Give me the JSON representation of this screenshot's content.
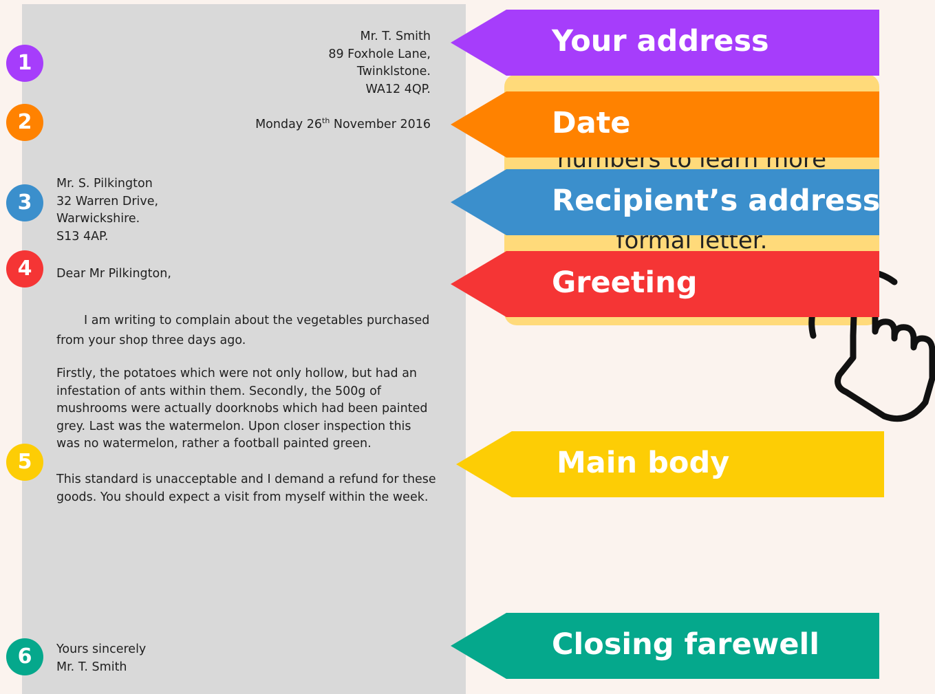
{
  "letter": {
    "sender": [
      "Mr. T. Smith",
      "89 Foxhole Lane,",
      "Twinklstone.",
      "WA12 4QP."
    ],
    "date": {
      "prefix": "Monday 26",
      "suffix": "th",
      "rest": " November 2016"
    },
    "recipient": [
      "Mr. S. Pilkington",
      "32 Warren Drive,",
      "Warwickshire.",
      "S13 4AP."
    ],
    "greeting": "Dear Mr Pilkington,",
    "body": [
      "I am writing to complain about the vegetables purchased from your shop three days ago.",
      "Firstly, the potatoes which were not only hollow, but had an infestation of ants within them. Secondly, the 500g of mushrooms were actually doorknobs which had been painted grey. Last was the watermelon. Upon closer inspection this was no watermelon, rather a football painted green.",
      "This standard is unacceptable and I demand a refund for these goods. You should expect a visit from myself within the week."
    ],
    "closing": [
      "Yours sincerely",
      "Mr. T. Smith"
    ]
  },
  "badges": [
    {
      "number": "1",
      "color": "#a63dfb"
    },
    {
      "number": "2",
      "color": "#ff8200"
    },
    {
      "number": "3",
      "color": "#3b8fcc"
    },
    {
      "number": "4",
      "color": "#f53535"
    },
    {
      "number": "5",
      "color": "#fdcd05"
    },
    {
      "number": "6",
      "color": "#05a88c"
    }
  ],
  "labels": [
    {
      "text": "Your address",
      "color": "#a63dfb"
    },
    {
      "text": "Date",
      "color": "#ff8200"
    },
    {
      "text": "Recipient’s address",
      "color": "#3b8fcc"
    },
    {
      "text": "Greeting",
      "color": "#f53535"
    },
    {
      "text": "Main body",
      "color": "#fdcd05"
    },
    {
      "text": "Closing farewell",
      "color": "#05a88c"
    }
  ],
  "hidden_card": {
    "line1": "numbers to learn more",
    "line2": "formal letter.",
    "color": "#ffda7a"
  },
  "icons": {
    "hand": "pointing-hand-icon"
  }
}
